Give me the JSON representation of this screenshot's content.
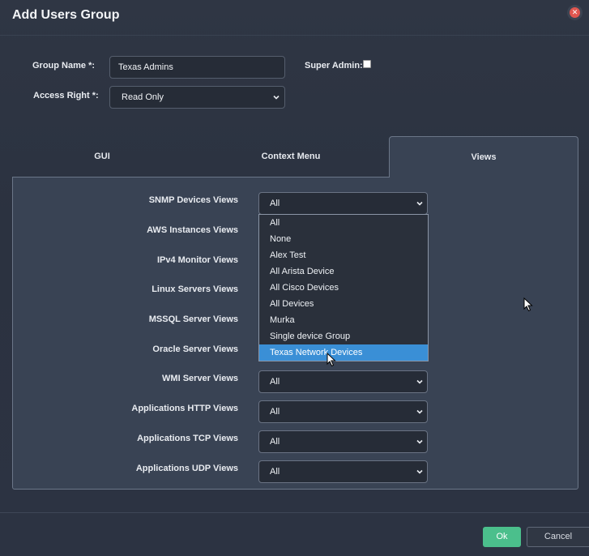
{
  "dialog": {
    "title": "Add Users Group",
    "close_icon": "close-icon"
  },
  "form": {
    "group_name_label": "Group Name *:",
    "group_name_value": "Texas Admins",
    "super_admin_label": "Super Admin:",
    "super_admin_checked": false,
    "access_right_label": "Access Right *:",
    "access_right_value": "Read Only"
  },
  "tabs": [
    {
      "label": "GUI",
      "active": false
    },
    {
      "label": "Context Menu",
      "active": false
    },
    {
      "label": "Views",
      "active": true
    }
  ],
  "views": [
    {
      "label": "SNMP Devices Views",
      "value": "All"
    },
    {
      "label": "AWS Instances Views",
      "value": ""
    },
    {
      "label": "IPv4 Monitor Views",
      "value": ""
    },
    {
      "label": "Linux Servers Views",
      "value": ""
    },
    {
      "label": "MSSQL Server Views",
      "value": ""
    },
    {
      "label": "Oracle Server Views",
      "value": ""
    },
    {
      "label": "WMI Server Views",
      "value": "All"
    },
    {
      "label": "Applications HTTP Views",
      "value": "All"
    },
    {
      "label": "Applications TCP Views",
      "value": "All"
    },
    {
      "label": "Applications UDP Views",
      "value": "All"
    }
  ],
  "dropdown": {
    "options": [
      "All",
      "None",
      "Alex Test",
      "All Arista Device",
      "All Cisco Devices",
      "All Devices",
      "Murka",
      "Single device Group",
      "Texas Network Devices"
    ],
    "highlighted": "Texas Network Devices"
  },
  "footer": {
    "ok_label": "Ok",
    "cancel_label": "Cancel"
  },
  "colors": {
    "background": "#2b3240",
    "panel": "#394354",
    "highlight": "#3a8fd6",
    "ok_button": "#4bbf8c",
    "close": "#e0564f"
  }
}
